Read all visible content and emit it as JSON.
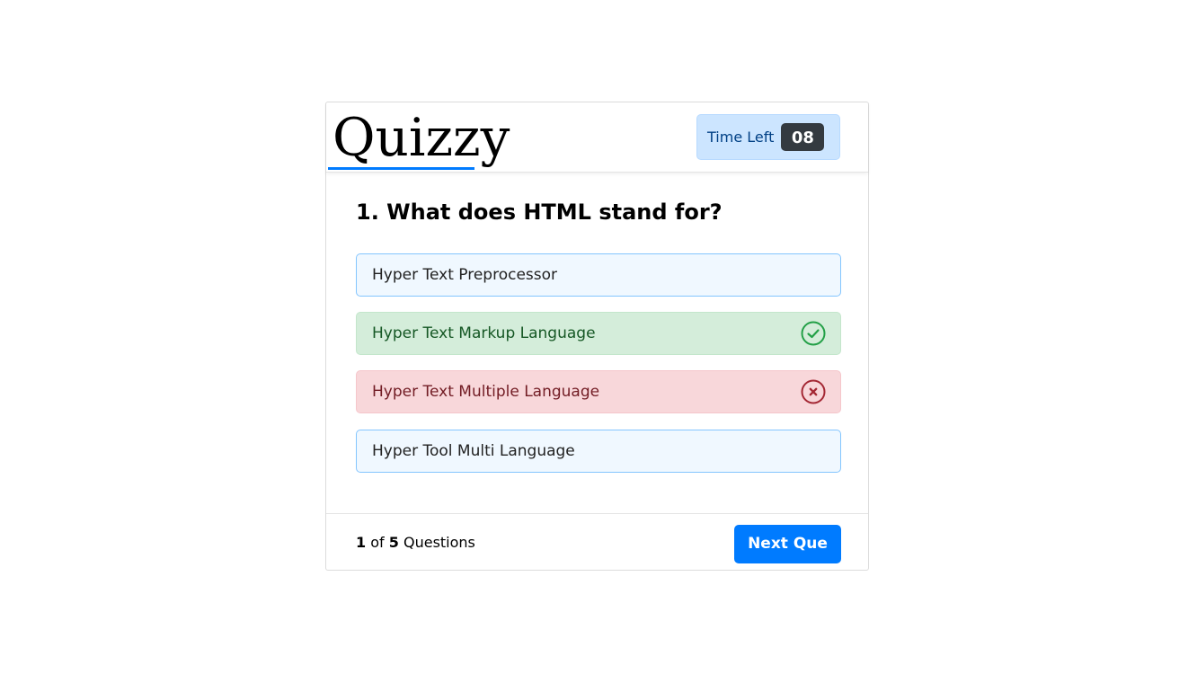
{
  "header": {
    "title": "Quizzy",
    "timer_label": "Time Left",
    "timer_value": "08"
  },
  "question": {
    "text": "1. What does HTML stand for?",
    "options": [
      {
        "text": "Hyper Text Preprocessor",
        "state": "default"
      },
      {
        "text": "Hyper Text Markup Language",
        "state": "correct",
        "icon": "check-circle-icon"
      },
      {
        "text": "Hyper Text Multiple Language",
        "state": "incorrect",
        "icon": "cross-circle-icon"
      },
      {
        "text": "Hyper Tool Multi Language",
        "state": "default"
      }
    ]
  },
  "footer": {
    "current": "1",
    "of_label": "of",
    "total": "5",
    "questions_label": "Questions",
    "next_button": "Next Que"
  },
  "colors": {
    "accent": "#007bff",
    "correct": "#155724",
    "incorrect": "#721c24"
  }
}
